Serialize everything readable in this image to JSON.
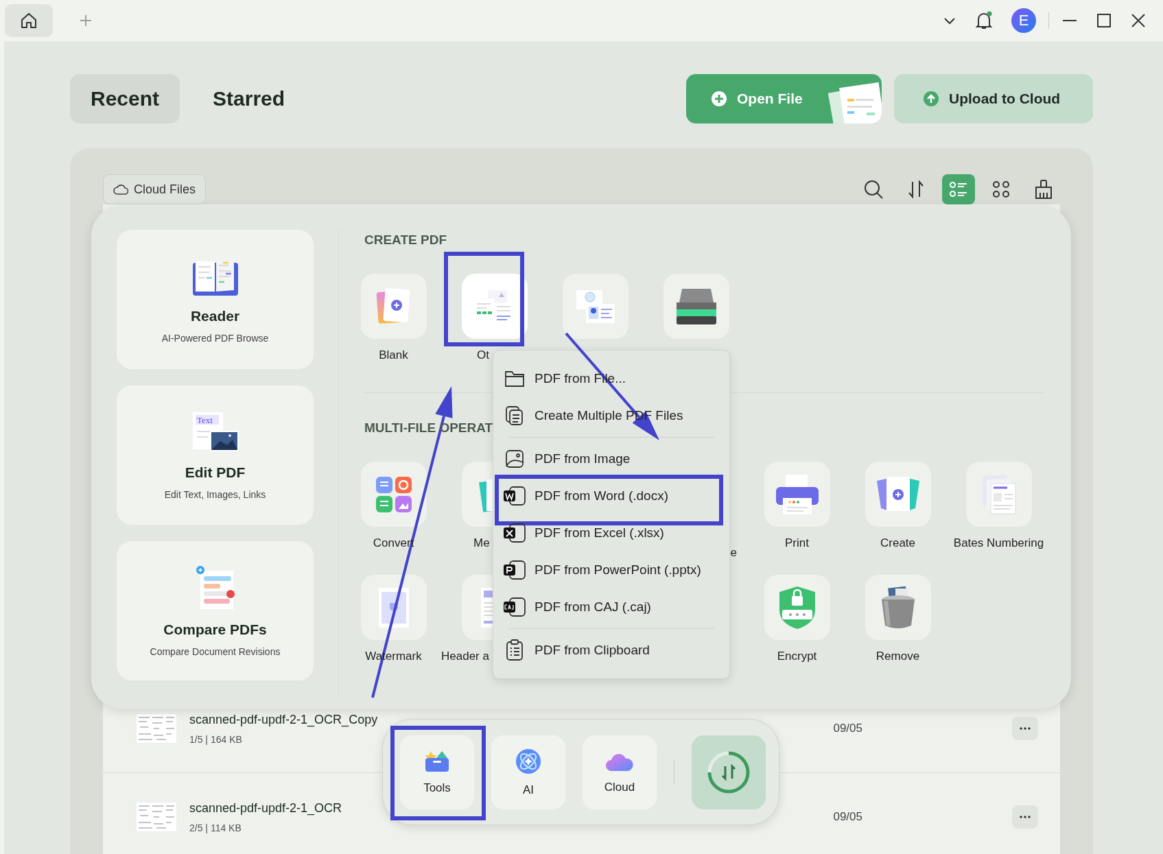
{
  "titlebar": {
    "home_tab": {
      "selected": true
    },
    "avatar": "E"
  },
  "tabs": [
    {
      "label": "Recent",
      "selected": true
    },
    {
      "label": "Starred",
      "selected": false
    }
  ],
  "actions": [
    {
      "label": "Open File",
      "kind": "primary"
    },
    {
      "label": "Upload to Cloud",
      "kind": "secondary"
    }
  ],
  "cloud_files": "Cloud Files",
  "toolbar": [
    {
      "kind": "search",
      "selected": false
    },
    {
      "kind": "sort",
      "selected": false
    },
    {
      "kind": "list",
      "selected": true
    },
    {
      "kind": "grid",
      "selected": false
    },
    {
      "kind": "clean",
      "selected": false
    }
  ],
  "files": [
    {
      "name": "scanned-pdf-updf-2-1_OCR_Copy",
      "info": "1/5 | 164 KB",
      "date": "09/05"
    },
    {
      "name": "scanned-pdf-updf-2-1_OCR",
      "info": "2/5 | 114 KB",
      "date": "09/05"
    }
  ],
  "tools_panel": {
    "features": [
      {
        "kind": "reader",
        "title": "Reader",
        "subtitle": "AI-Powered PDF Browse"
      },
      {
        "kind": "edit",
        "title": "Edit PDF",
        "subtitle": "Edit Text, Images, Links",
        "icon_text": "Text"
      },
      {
        "kind": "compare",
        "title": "Compare PDFs",
        "subtitle": "Compare Document Revisions"
      }
    ],
    "sections": [
      {
        "title": "CREATE PDF",
        "rows": [
          [
            {
              "kind": "blank",
              "label": "Blank",
              "highlighted": false
            },
            {
              "kind": "other",
              "label": "Ot",
              "highlighted": true
            },
            {
              "kind": "idcard",
              "highlighted": false
            },
            {
              "kind": "scanner",
              "highlighted": false
            }
          ]
        ]
      },
      {
        "title": "MULTI-FILE OPERAT",
        "rows": [
          [
            {
              "kind": "convert",
              "label": "Convert",
              "highlighted": false
            },
            {
              "kind": "merge",
              "label": "Me",
              "highlighted": false
            },
            "",
            {
              "kind": "none",
              "label": "e",
              "highlighted": false
            },
            {
              "kind": "print",
              "label": "Print",
              "highlighted": false
            },
            {
              "kind": "create",
              "label": "Create",
              "highlighted": false
            },
            {
              "kind": "bates",
              "label": "Bates Numbering",
              "highlighted": false
            }
          ],
          [
            {
              "kind": "watermark",
              "label": "Watermark",
              "highlighted": false
            },
            {
              "kind": "header",
              "label": "Header a",
              "highlighted": false
            },
            "",
            "",
            {
              "kind": "encrypt",
              "label": "Encrypt",
              "highlighted": false
            },
            {
              "kind": "remove",
              "label": "Remove",
              "highlighted": false
            }
          ]
        ]
      }
    ]
  },
  "context_menu": {
    "groups": [
      [
        {
          "kind": "folder",
          "label": "PDF from File...",
          "highlighted": false
        },
        {
          "kind": "multiple",
          "label": "Create Multiple PDF Files",
          "highlighted": false
        }
      ],
      [
        {
          "kind": "image",
          "label": "PDF from Image",
          "highlighted": false
        },
        {
          "kind": "word",
          "label": "PDF from Word (.docx)",
          "highlighted": true
        },
        {
          "kind": "excel",
          "label": "PDF from Excel (.xlsx)",
          "highlighted": false
        },
        {
          "kind": "ppt",
          "label": "PDF from PowerPoint (.pptx)",
          "highlighted": false
        },
        {
          "kind": "caj",
          "label": "PDF from CAJ (.caj)",
          "highlighted": false
        }
      ],
      [
        {
          "kind": "clipboard",
          "label": "PDF from Clipboard",
          "highlighted": false
        }
      ]
    ]
  },
  "dock": [
    {
      "kind": "tools",
      "label": "Tools",
      "highlighted": true
    },
    {
      "kind": "ai",
      "label": "AI",
      "highlighted": false
    },
    {
      "kind": "cloud",
      "label": "Cloud",
      "highlighted": false
    },
    {
      "kind": "sync",
      "highlighted": false
    }
  ],
  "arrows": [
    {
      "kind": "up"
    },
    {
      "kind": "down"
    }
  ]
}
